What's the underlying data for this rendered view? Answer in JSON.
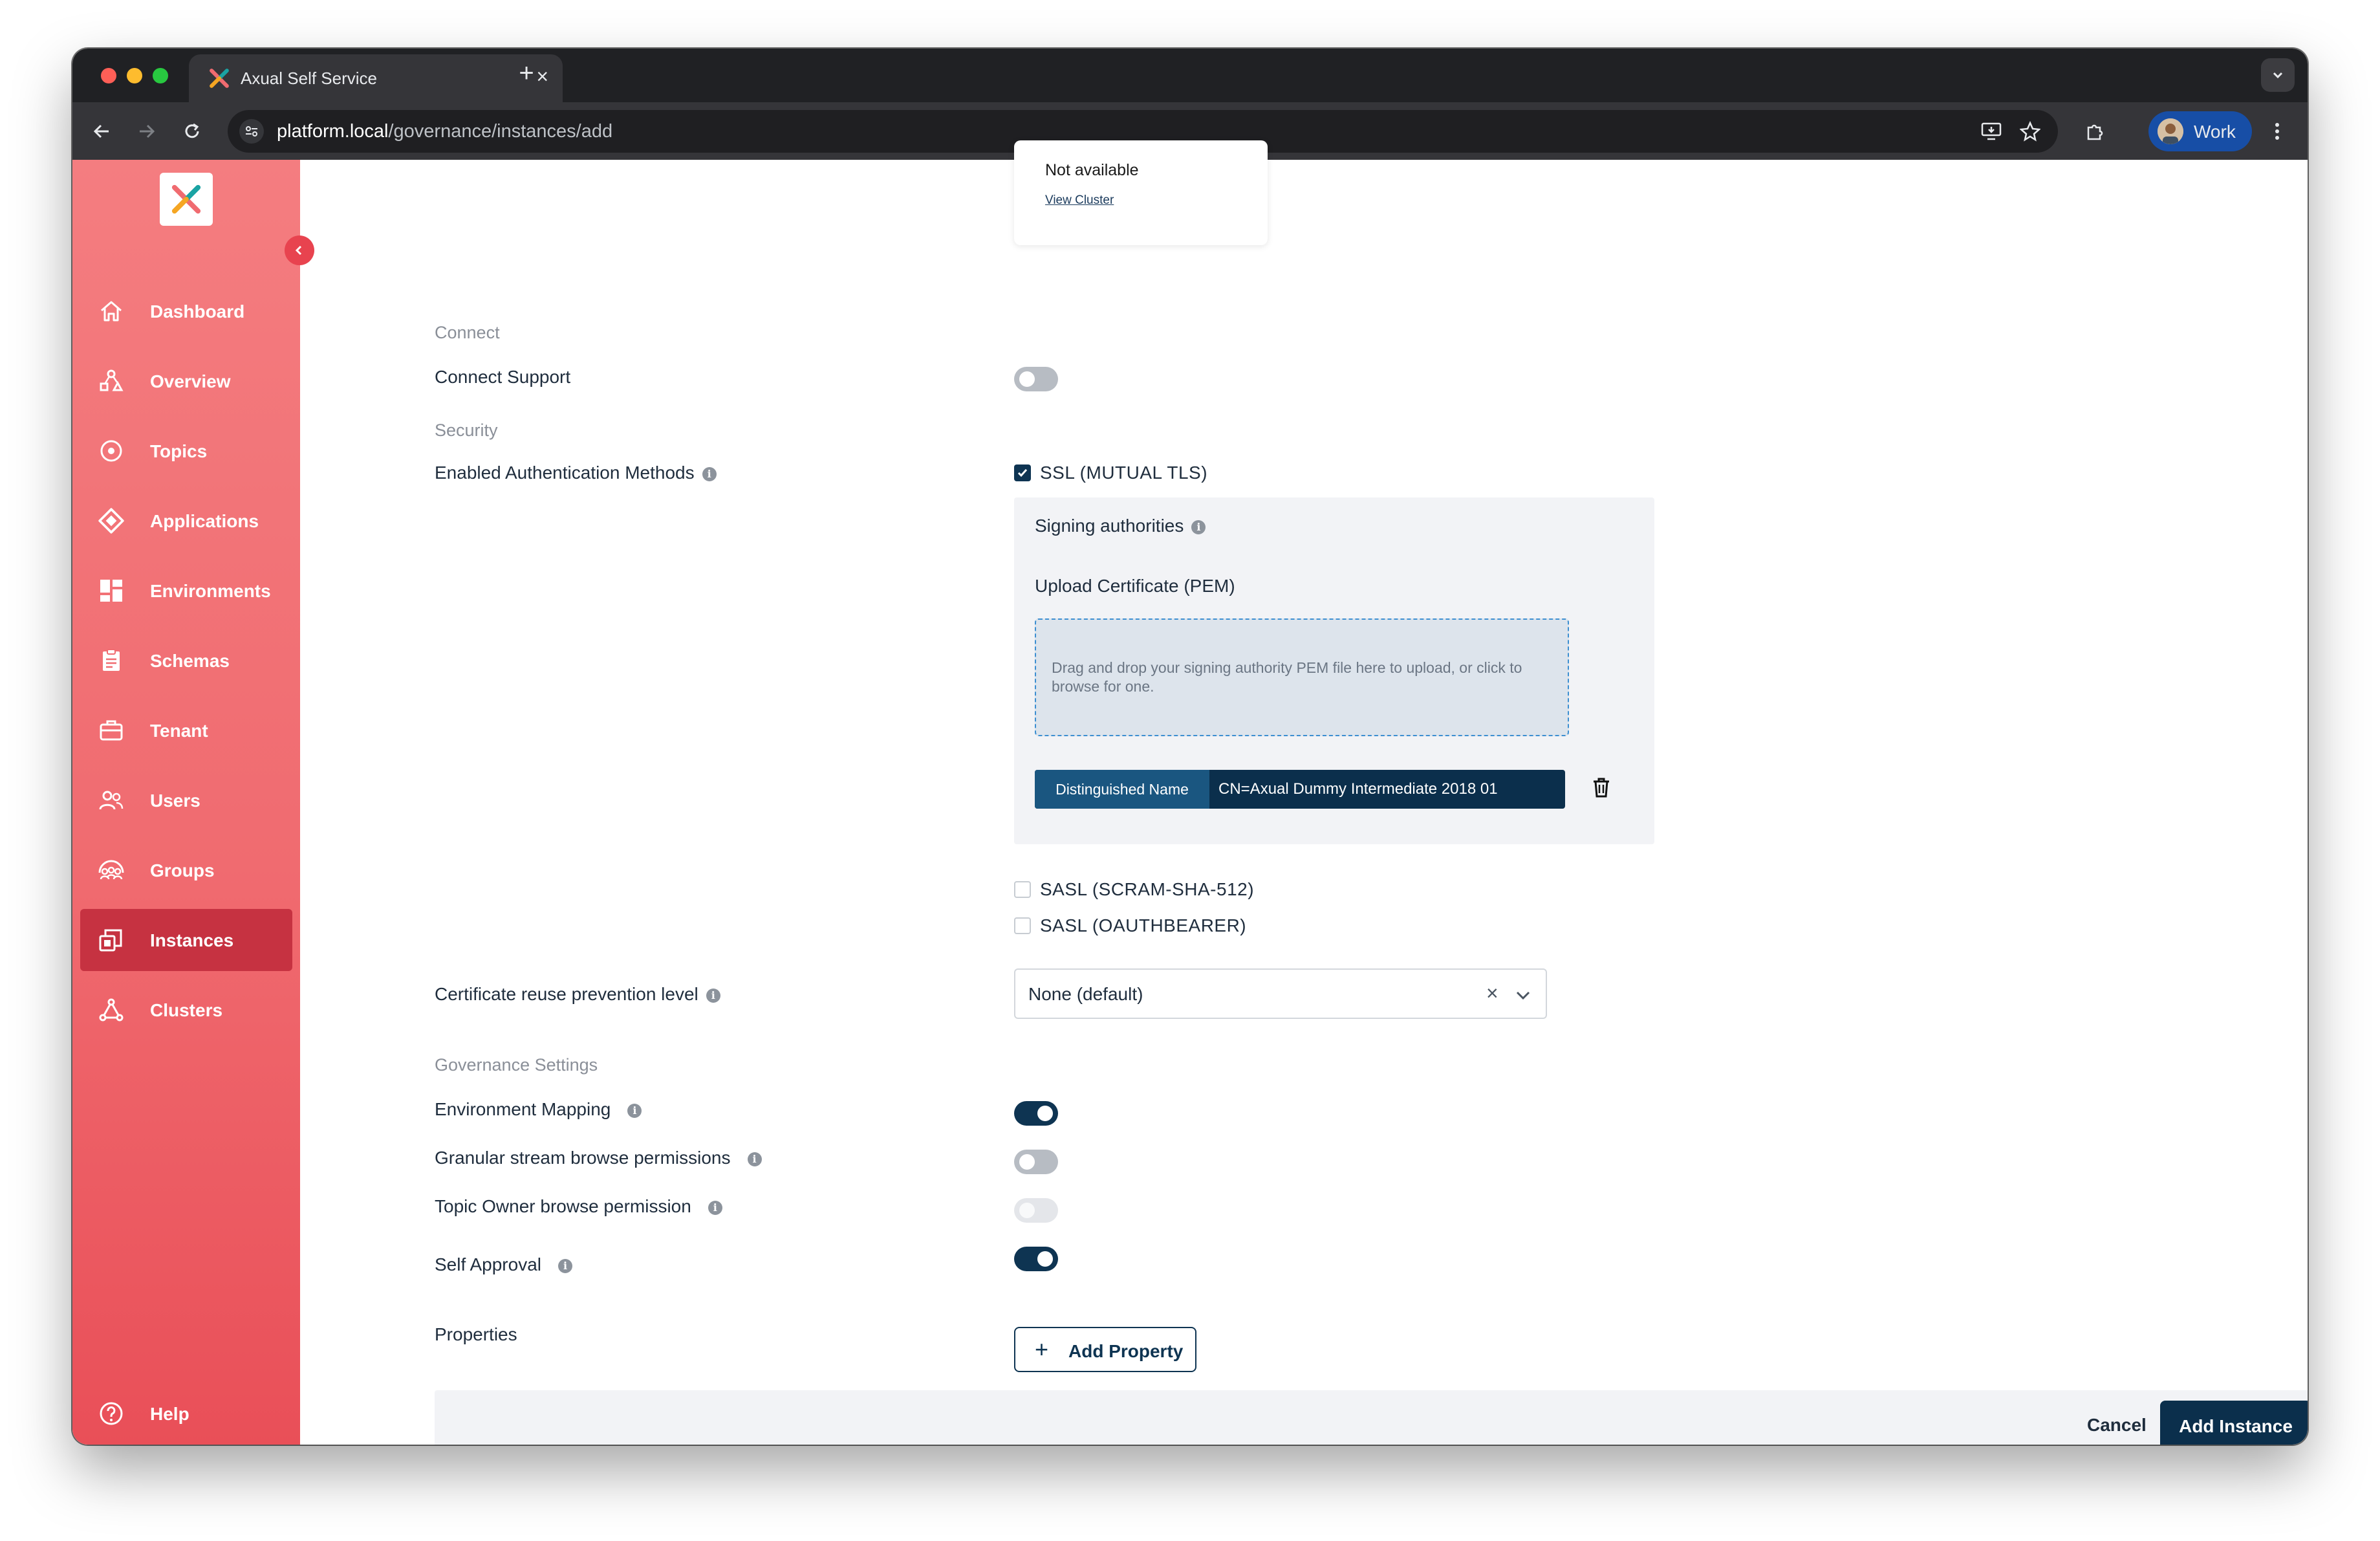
{
  "browser": {
    "tab_title": "Axual Self Service",
    "url_host": "platform.local",
    "url_path": "/governance/instances/add",
    "profile_label": "Work"
  },
  "sidebar": {
    "items": [
      {
        "label": "Dashboard",
        "icon": "home-icon"
      },
      {
        "label": "Overview",
        "icon": "overview-icon"
      },
      {
        "label": "Topics",
        "icon": "topics-icon"
      },
      {
        "label": "Applications",
        "icon": "applications-icon"
      },
      {
        "label": "Environments",
        "icon": "environments-icon"
      },
      {
        "label": "Schemas",
        "icon": "schemas-icon"
      },
      {
        "label": "Tenant",
        "icon": "tenant-icon"
      },
      {
        "label": "Users",
        "icon": "users-icon"
      },
      {
        "label": "Groups",
        "icon": "groups-icon"
      },
      {
        "label": "Instances",
        "icon": "instances-icon",
        "active": true
      },
      {
        "label": "Clusters",
        "icon": "clusters-icon"
      }
    ],
    "help_label": "Help"
  },
  "cluster_card": {
    "status": "Not available",
    "link": "View Cluster"
  },
  "connect": {
    "section": "Connect",
    "support_label": "Connect Support",
    "support_enabled": false
  },
  "security": {
    "section": "Security",
    "auth_methods_label": "Enabled Authentication Methods",
    "methods": [
      {
        "label": "SSL (MUTUAL TLS)",
        "checked": true
      },
      {
        "label": "SASL (SCRAM-SHA-512)",
        "checked": false
      },
      {
        "label": "SASL (OAUTHBEARER)",
        "checked": false
      }
    ],
    "signing_authorities_label": "Signing authorities",
    "upload_label": "Upload Certificate (PEM)",
    "dropzone_hint": "Drag and drop your signing authority PEM file here to upload, or click to browse for one.",
    "certificate": {
      "key": "Distinguished Name",
      "value": "CN=Axual Dummy Intermediate 2018 01"
    },
    "reuse_label": "Certificate reuse prevention level",
    "reuse_value": "None (default)"
  },
  "governance": {
    "section": "Governance Settings",
    "env_mapping": {
      "label": "Environment Mapping",
      "enabled": true
    },
    "granular_browse": {
      "label": "Granular stream browse permissions",
      "enabled": false
    },
    "owner_browse": {
      "label": "Topic Owner browse permission",
      "enabled": false,
      "disabled": true
    },
    "self_approval": {
      "label": "Self Approval",
      "enabled": true
    }
  },
  "properties": {
    "label": "Properties",
    "add_button": "Add Property"
  },
  "footer": {
    "cancel": "Cancel",
    "submit": "Add Instance"
  },
  "colors": {
    "sidebar_top": "#f47d80",
    "sidebar_bottom": "#e94f58",
    "sidebar_active": "#c63241",
    "primary": "#0b2f4c"
  }
}
